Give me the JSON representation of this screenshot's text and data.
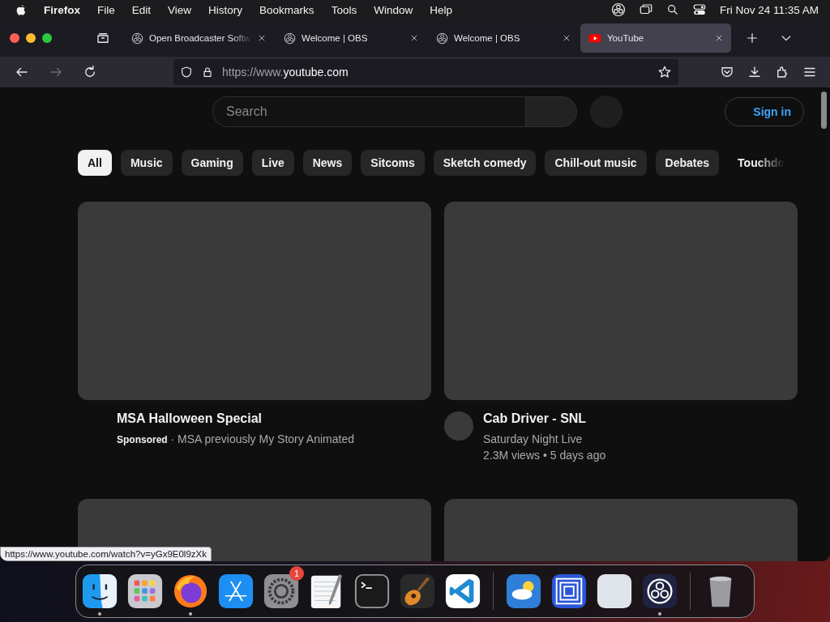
{
  "menu_bar": {
    "app": "Firefox",
    "menus": [
      "File",
      "Edit",
      "View",
      "History",
      "Bookmarks",
      "Tools",
      "Window",
      "Help"
    ],
    "clock": "Fri Nov 24  11:35 AM"
  },
  "tabs": [
    {
      "title": "Open Broadcaster Softw",
      "kind": "obs",
      "selected": false
    },
    {
      "title": "Welcome | OBS",
      "kind": "obs",
      "selected": false
    },
    {
      "title": "Welcome | OBS",
      "kind": "obs",
      "selected": false
    },
    {
      "title": "YouTube",
      "kind": "youtube",
      "selected": true
    }
  ],
  "nav_buttons": [
    {
      "kind": "back",
      "disabled": false
    },
    {
      "kind": "forward",
      "disabled": true
    },
    {
      "kind": "reload",
      "disabled": false
    }
  ],
  "address": {
    "prefix": "https://www.",
    "host": "youtube.com"
  },
  "search": {
    "placeholder": "Search"
  },
  "sign_in": "Sign in",
  "chips": [
    {
      "label": "All",
      "selected": true
    },
    {
      "label": "Music",
      "selected": false
    },
    {
      "label": "Gaming",
      "selected": false
    },
    {
      "label": "Live",
      "selected": false
    },
    {
      "label": "News",
      "selected": false
    },
    {
      "label": "Sitcoms",
      "selected": false
    },
    {
      "label": "Sketch comedy",
      "selected": false
    },
    {
      "label": "Chill-out music",
      "selected": false
    },
    {
      "label": "Debates",
      "selected": false
    },
    {
      "label": "Touchdo",
      "selected": false
    }
  ],
  "videos": [
    {
      "kind": "ad",
      "title": "MSA Halloween Special",
      "byline": "**Sponsored** · MSA previously My Story Animated"
    },
    {
      "kind": "video",
      "title": "Cab Driver - SNL",
      "channel": "Saturday Night Live",
      "stats": "2.3M views • 5 days ago"
    }
  ],
  "status_link": "https://www.youtube.com/watch?v=yGx9E0l9zXk",
  "dock": [
    {
      "kind": "finder",
      "running": true
    },
    {
      "kind": "launchpad",
      "running": false
    },
    {
      "kind": "firefox",
      "running": true
    },
    {
      "kind": "appstore",
      "running": false
    },
    {
      "kind": "settings",
      "running": false,
      "badge": "1"
    },
    {
      "kind": "textedit",
      "running": false
    },
    {
      "kind": "terminal",
      "running": false
    },
    {
      "kind": "garageband",
      "running": false
    },
    {
      "kind": "vscode",
      "running": false
    },
    {
      "kind": "separator"
    },
    {
      "kind": "weather",
      "running": false
    },
    {
      "kind": "squares",
      "running": false
    },
    {
      "kind": "blank",
      "running": false
    },
    {
      "kind": "obs",
      "running": true
    },
    {
      "kind": "separator"
    },
    {
      "kind": "trash",
      "running": false
    }
  ]
}
